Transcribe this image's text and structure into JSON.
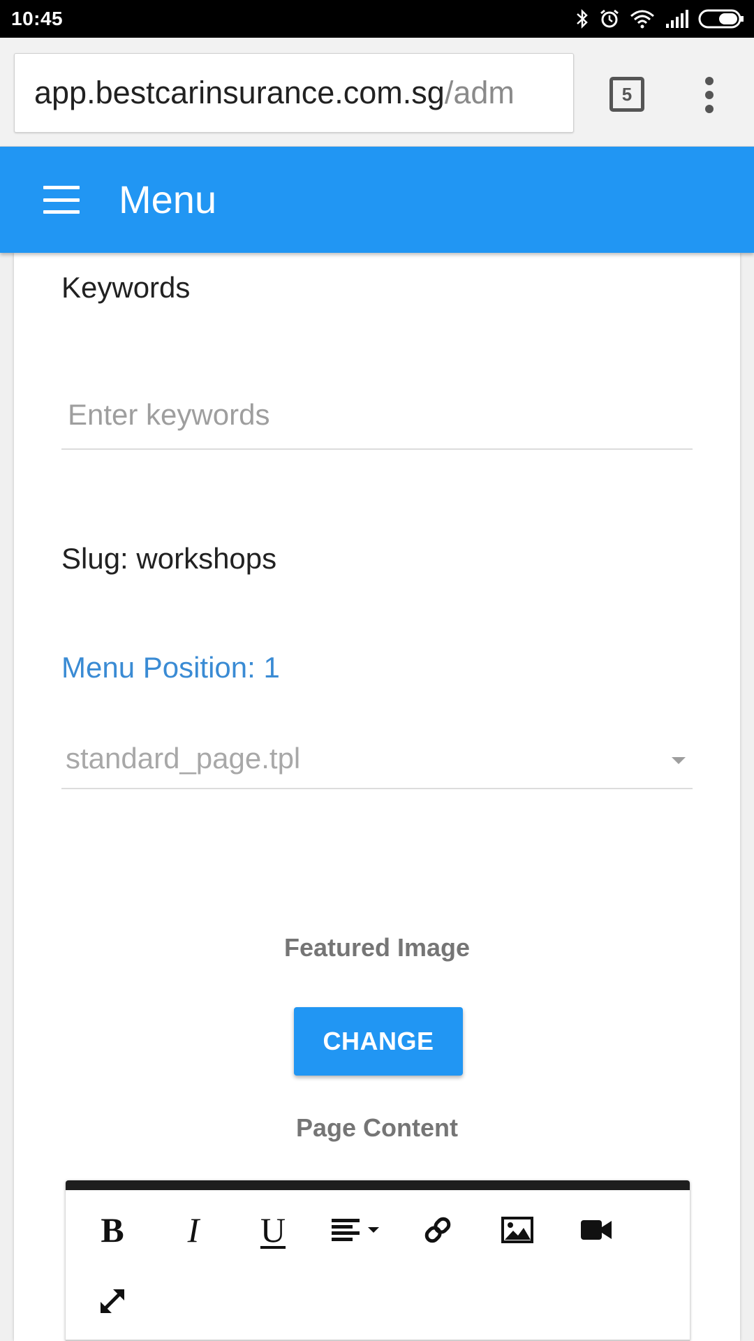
{
  "status_bar": {
    "time": "10:45",
    "icons": [
      "bluetooth-icon",
      "alarm-icon",
      "wifi-icon",
      "signal-icon",
      "battery-icon"
    ]
  },
  "browser": {
    "url_domain": "app.bestcarinsurance.com.sg",
    "url_path": "/adm",
    "tab_count": "5",
    "menu_icon": "overflow-menu-icon"
  },
  "header": {
    "title": "Menu",
    "menu_icon": "hamburger-icon",
    "background": "#2196f3"
  },
  "form": {
    "keywords_label": "Keywords",
    "keywords_placeholder": "Enter keywords",
    "keywords_value": "",
    "slug_text": "Slug: workshops",
    "menu_position_text": "Menu Position: 1",
    "template_value": "standard_page.tpl",
    "featured_image_label": "Featured Image",
    "change_button": "CHANGE",
    "page_content_label": "Page Content"
  },
  "editor_toolbar": {
    "bold": "B",
    "italic": "I",
    "underline": "U",
    "tools": [
      "bold-icon",
      "italic-icon",
      "underline-icon",
      "align-icon",
      "link-icon",
      "image-icon",
      "video-icon",
      "fullscreen-icon"
    ]
  },
  "colors": {
    "accent": "#2196f3",
    "link_text": "#3a8bd4"
  }
}
